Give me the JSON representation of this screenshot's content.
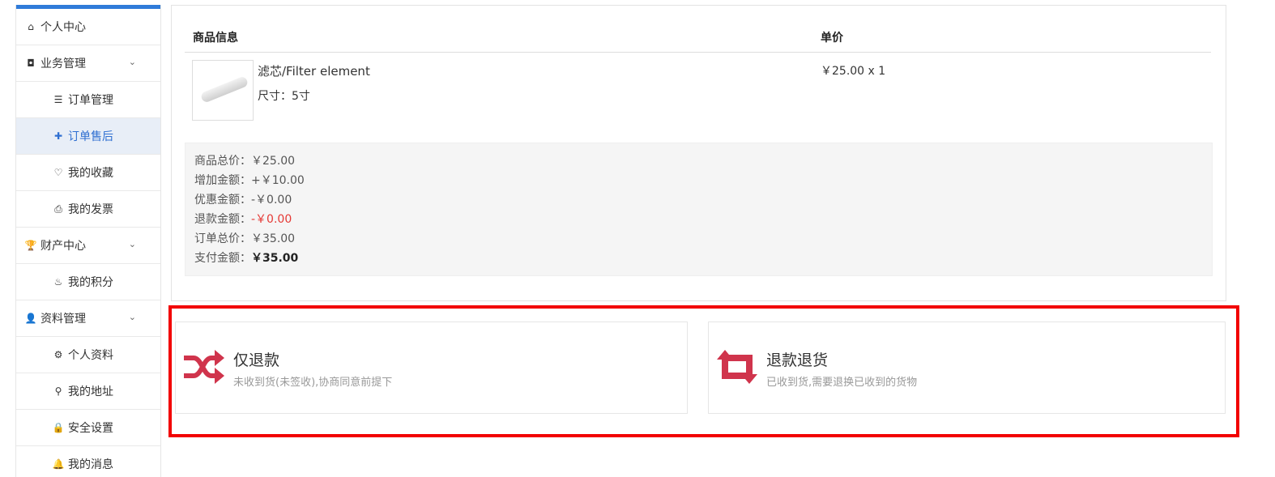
{
  "sidebar": {
    "items": [
      {
        "label": "个人中心",
        "icon": "home-icon",
        "glyph": "⌂",
        "kind": "group"
      },
      {
        "label": "业务管理",
        "icon": "cube-icon",
        "glyph": "◘",
        "kind": "group",
        "expandable": true
      },
      {
        "label": "订单管理",
        "icon": "list-icon",
        "glyph": "☰",
        "kind": "sub"
      },
      {
        "label": "订单售后",
        "icon": "puzzle-icon",
        "glyph": "✚",
        "kind": "sub",
        "active": true
      },
      {
        "label": "我的收藏",
        "icon": "heart-icon",
        "glyph": "♡",
        "kind": "sub"
      },
      {
        "label": "我的发票",
        "icon": "printer-icon",
        "glyph": "⎙",
        "kind": "sub"
      },
      {
        "label": "财产中心",
        "icon": "trophy-icon",
        "glyph": "🏆",
        "kind": "group",
        "expandable": true
      },
      {
        "label": "我的积分",
        "icon": "fire-icon",
        "glyph": "♨",
        "kind": "sub"
      },
      {
        "label": "资料管理",
        "icon": "user-icon",
        "glyph": "👤",
        "kind": "group",
        "expandable": true
      },
      {
        "label": "个人资料",
        "icon": "gear-icon",
        "glyph": "⚙",
        "kind": "sub"
      },
      {
        "label": "我的地址",
        "icon": "location-icon",
        "glyph": "⚲",
        "kind": "sub"
      },
      {
        "label": "安全设置",
        "icon": "lock-icon",
        "glyph": "🔒",
        "kind": "sub"
      },
      {
        "label": "我的消息",
        "icon": "bell-icon",
        "glyph": "🔔",
        "kind": "sub"
      }
    ],
    "chevron": "⌄",
    "accent": "#2f7bd9"
  },
  "order": {
    "headers": {
      "product": "商品信息",
      "price": "单价"
    },
    "product": {
      "name": "滤芯/Filter element",
      "size": "尺寸：5寸",
      "price_qty": "￥25.00 x 1"
    },
    "summary": [
      {
        "label": "商品总价：",
        "value": "￥25.00",
        "style": "normal"
      },
      {
        "label": "增加金额：",
        "value": "+￥10.00",
        "style": "normal"
      },
      {
        "label": "优惠金额：",
        "value": "-￥0.00",
        "style": "normal"
      },
      {
        "label": "退款金额：",
        "value": "-￥0.00",
        "style": "red"
      },
      {
        "label": "订单总价：",
        "value": "￥35.00",
        "style": "normal"
      },
      {
        "label": "支付金额：",
        "value": "￥35.00",
        "style": "bold"
      }
    ]
  },
  "aftersale": {
    "options": [
      {
        "title": "仅退款",
        "desc": "未收到货(未签收),协商同意前提下",
        "icon": "shuffle-icon"
      },
      {
        "title": "退款退货",
        "desc": "已收到货,需要退换已收到的货物",
        "icon": "retweet-icon"
      }
    ],
    "icon_color": "#d0344c",
    "highlight_color": "#f20000"
  }
}
